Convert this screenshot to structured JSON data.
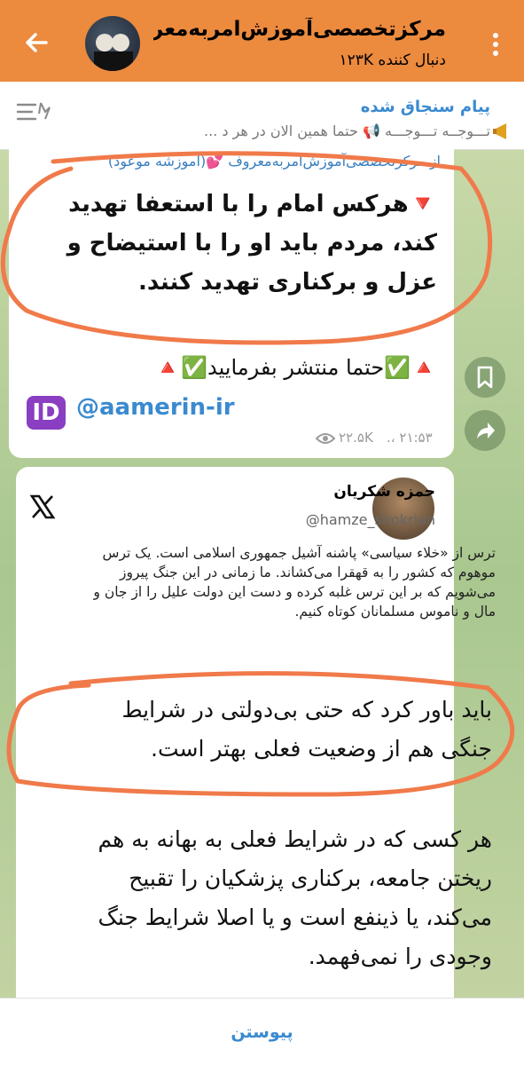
{
  "header": {
    "title": "مرکزتخصصی‌آموزش‌امربه‌معرو...",
    "subtitle": "دنبال کننده ۱۲۳K"
  },
  "pinned": {
    "label": "پیام سنجاق شده",
    "text": "تـــوجــه تـــوجـــه 📢 حتما همین الان در هر د ..."
  },
  "message1": {
    "forward_from": "از  مرکزتخصصی‌آموزش‌امربه‌معروف 💕(اموزشه موعود)",
    "body": "🔻هرکس امام را با استعفا تهدید کند، مردم باید او را با استیضاح و عزل و برکناری تهدید کنند.",
    "cta": "🔺✅حتما منتشر بفرمایید✅🔺",
    "id_badge": "ID",
    "handle": "@aamerin-ir",
    "time": "۲۱:۵۳ ،.",
    "views": "۲۲.۵K"
  },
  "tweet": {
    "name": "حمزه شکریان",
    "username": "@hamze_shokrian",
    "body": "ترس از «خلاء سیاسی» پاشنه آشیل جمهوری اسلامی است. یک ترس موهوم که کشور را به قهقرا می‌کشاند. ما زمانی در این جنگ پیروز می‌شویم که بر این ترس غلبه کرده و دست این دولت علیل را از جان و مال و ناموس مسلمانان کوتاه کنیم."
  },
  "image_text": {
    "p1": "باید باور کرد که حتی بی‌دولتی در شرایط جنگی هم از وضعیت فعلی بهتر است.",
    "p2": "هر کسی که در شرایط فعلی به بهانه به هم ریختن جامعه، برکناری پزشکیان را تقبیح می‌کند، یا ذینفع است و یا اصلا شرایط جنگ وجودی را نمی‌فهمد."
  },
  "bottom": {
    "join_label": "پیوستن"
  },
  "colors": {
    "header_bg": "#ec8a3e",
    "accent": "#3a8ad0",
    "annotation": "#f07a4a"
  }
}
